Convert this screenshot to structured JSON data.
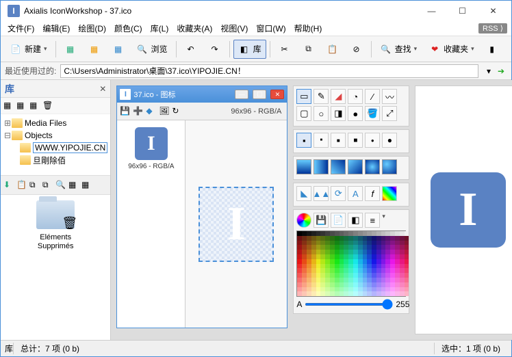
{
  "titlebar": {
    "app_icon_letter": "I",
    "title": "Axialis IconWorkshop - 37.ico"
  },
  "menubar": {
    "items": [
      "文件(F)",
      "编辑(E)",
      "绘图(D)",
      "颜色(C)",
      "库(L)",
      "收藏夹(A)",
      "视图(V)",
      "窗口(W)",
      "帮助(H)"
    ],
    "rss": "RSS ⟩"
  },
  "toolbar": {
    "new_label": "新建",
    "browse_label": "浏览",
    "lib_label": "库",
    "search_label": "查找",
    "fav_label": "收藏夹"
  },
  "pathbar": {
    "label": "最近使用过的:",
    "path": "C:\\Users\\Administrator\\桌面\\37.ico\\YIPOJIE.CN！"
  },
  "lib_panel": {
    "title": "库",
    "tree": {
      "root_items": [
        {
          "label": "Media Files"
        },
        {
          "label": "Objects"
        }
      ],
      "tooltip": "WWW.YIPOJIE.CN",
      "garbage": "旦剛除佰"
    },
    "item_caption": "Eléments\nSupprimés"
  },
  "doc": {
    "title": "37.ico - 图标",
    "format_info": "96x96 - RGB/A",
    "thumb_caption": "96x96 - RGB/A"
  },
  "alpha": {
    "label": "A",
    "value": "255"
  },
  "statusbar": {
    "lib_label": "库",
    "total": "总计：7 项 (0 b)",
    "selected": "选中：1 项 (0 b)"
  }
}
